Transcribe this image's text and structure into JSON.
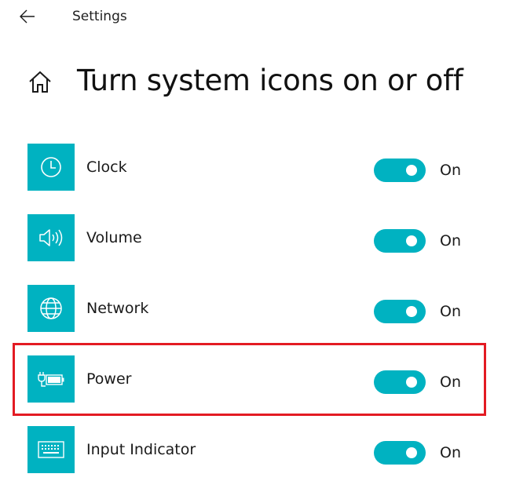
{
  "header": {
    "app_title": "Settings",
    "back_icon": "back-arrow-icon"
  },
  "page": {
    "home_icon": "home-icon",
    "title": "Turn system icons on or off"
  },
  "colors": {
    "accent": "#00b2c1",
    "highlight": "#e31b23"
  },
  "items": [
    {
      "label": "Clock",
      "icon": "clock-icon",
      "state": "On",
      "enabled": true
    },
    {
      "label": "Volume",
      "icon": "volume-icon",
      "state": "On",
      "enabled": true
    },
    {
      "label": "Network",
      "icon": "network-globe-icon",
      "state": "On",
      "enabled": true
    },
    {
      "label": "Power",
      "icon": "power-battery-icon",
      "state": "On",
      "enabled": true
    },
    {
      "label": "Input Indicator",
      "icon": "keyboard-icon",
      "state": "On",
      "enabled": true
    }
  ]
}
